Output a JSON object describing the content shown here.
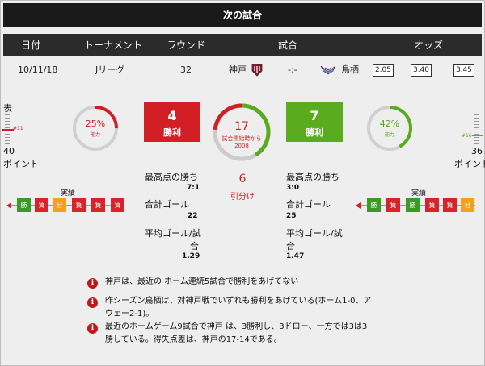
{
  "title": "次の試合",
  "header": {
    "date": "日付",
    "tournament": "トーナメント",
    "round": "ラウンド",
    "match": "試合",
    "odds": "オッズ"
  },
  "match_row": {
    "date": "10/11/18",
    "tournament": "Jリーグ",
    "round": "32",
    "home": "神戸",
    "score": "-:-",
    "away": "鳥栖",
    "odds": [
      "2.05",
      "3.40",
      "3.45"
    ]
  },
  "home": {
    "side_label": "表",
    "rank_marker": "#11",
    "points_value": "40",
    "points_label": "ポイント",
    "power_pct_text": "25%",
    "power_pct": 25,
    "power_label": "能力",
    "wins": "4",
    "wins_label": "勝利",
    "record_label": "実績",
    "form": [
      "勝",
      "負",
      "分",
      "負",
      "負",
      "負"
    ],
    "stats": {
      "top_win_label": "最高点の勝ち",
      "top_win_value": "7:1",
      "total_goals_label": "合計ゴール",
      "total_goals_value": "22",
      "avg_goals_label_1": "平均ゴール/試",
      "avg_goals_label_2": "合",
      "avg_goals_value": "1.29"
    }
  },
  "center": {
    "matches": "17",
    "matches_label": "試合開始時から",
    "since_year": "2008",
    "home_share_pct": 23.5,
    "away_share_pct": 41.2,
    "draws": "6",
    "draws_label": "引分け"
  },
  "away": {
    "rank_marker": "#16",
    "points_value": "36",
    "points_label": "ポイント",
    "power_pct_text": "42%",
    "power_pct": 42,
    "power_label": "能力",
    "wins": "7",
    "wins_label": "勝利",
    "record_label": "実績",
    "form": [
      "勝",
      "負",
      "勝",
      "負",
      "負",
      "分"
    ],
    "stats": {
      "top_win_label": "最高点の勝ち",
      "top_win_value": "3:0",
      "total_goals_label": "合計ゴール",
      "total_goals_value": "25",
      "avg_goals_label_1": "平均ゴール/試",
      "avg_goals_label_2": "合",
      "avg_goals_value": "1.47"
    }
  },
  "notes": [
    "神戸は、最近の ホーム連続5試合で勝利をあげてない",
    "昨シーズン鳥栖は、対神戸戦でいずれも勝利をあげている(ホーム1-0、ア",
    "ウェー2-1)。",
    "最近のホームゲーム9試合で神戸 は、3勝利し、3ドロー、一方では3は3",
    "勝している。得失点差は、神戸の17-14である。"
  ],
  "colors": {
    "home": "#d21f26",
    "away": "#5aab1e",
    "win": "#3a9b25",
    "loss": "#d6242a",
    "draw": "#f4a019",
    "dark": "#2b2b2b"
  },
  "icons": {
    "info": "info-icon",
    "home_crest": "vissel-kobe-crest-icon",
    "away_crest": "sagan-tosu-crest-icon",
    "form_arrow": "arrow-left-icon"
  }
}
